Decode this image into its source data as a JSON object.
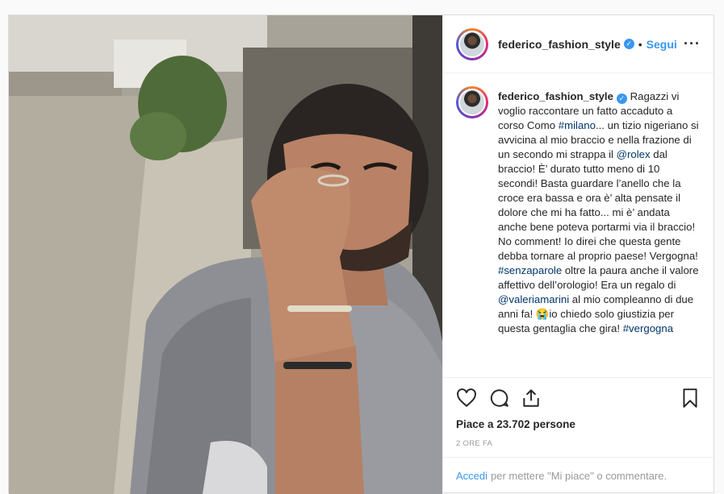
{
  "header": {
    "username": "federico_fashion_style",
    "dot": "•",
    "follow_label": "Segui",
    "more_label": "•••"
  },
  "caption": {
    "username": "federico_fashion_style",
    "segments": [
      {
        "text": " Ragazzi vi voglio raccontare un fatto accaduto a corso Como ",
        "tag": false
      },
      {
        "text": "#milano",
        "tag": true
      },
      {
        "text": "... un tizio nigeriano si avvicina al mio braccio e nella frazione di un secondo mi strappa il ",
        "tag": false
      },
      {
        "text": "@rolex",
        "tag": true
      },
      {
        "text": " dal braccio! È’ durato tutto meno di 10 secondi! Basta guardare l’anello che la croce era bassa e ora è’ alta pensate il dolore che mi ha fatto... mi è’ andata anche bene poteva portarmi via il braccio! No comment! Io direi che questa gente debba tornare al proprio paese! Vergogna! ",
        "tag": false
      },
      {
        "text": "#senzaparole",
        "tag": true
      },
      {
        "text": " oltre la paura anche il valore affettivo dell’orologio! Era un regalo di ",
        "tag": false
      },
      {
        "text": "@valeriamarini",
        "tag": true
      },
      {
        "text": " al mio compleanno di due anni fa! 😭io chiedo solo giustizia per questa gentaglia che gira! ",
        "tag": false
      },
      {
        "text": "#vergogna",
        "tag": true
      }
    ]
  },
  "actions": {
    "like_icon": "heart-icon",
    "comment_icon": "comment-icon",
    "share_icon": "share-icon",
    "save_icon": "bookmark-icon"
  },
  "likes_text": "Piace a 23.702 persone",
  "time_text": "2 ORE FA",
  "login": {
    "link_label": "Accedi",
    "rest_text": "per mettere \"Mi piace\" o commentare."
  },
  "colors": {
    "accent": "#3897f0",
    "hashtag": "#003569",
    "border": "#dbdbdb"
  }
}
